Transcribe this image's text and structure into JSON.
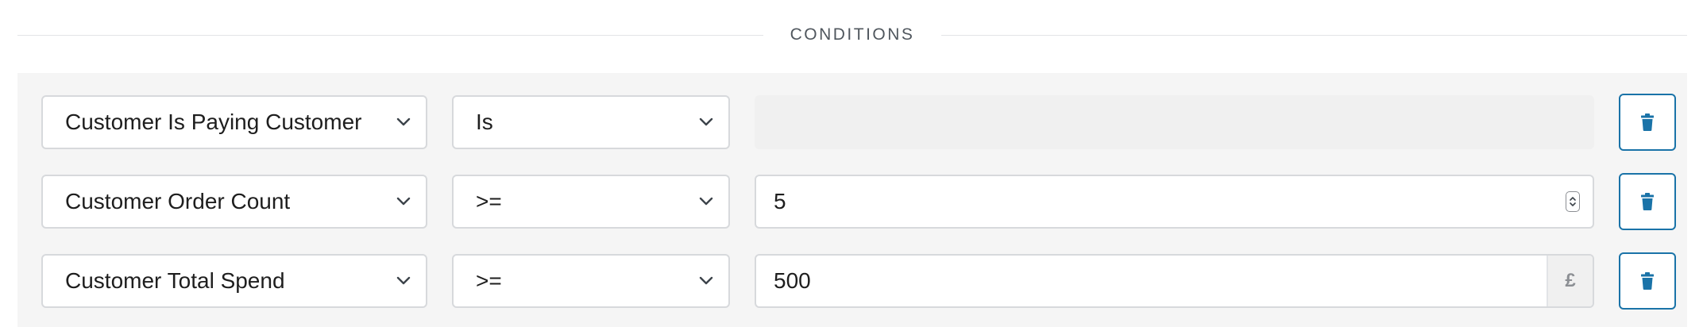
{
  "section": {
    "title": "CONDITIONS"
  },
  "conditions": [
    {
      "field": "Customer Is Paying Customer",
      "operator": "Is",
      "value": "",
      "value_state": "disabled"
    },
    {
      "field": "Customer Order Count",
      "operator": ">=",
      "value": "5",
      "value_state": "number"
    },
    {
      "field": "Customer Total Spend",
      "operator": ">=",
      "value": "500",
      "value_state": "currency",
      "currency_symbol": "£"
    }
  ],
  "icons": {
    "select_arrow": "chevron-down-icon",
    "delete": "trash-icon",
    "number_spin": "spinner-icon"
  },
  "colors": {
    "accent": "#1a73a8",
    "panel_bg": "#f5f5f5",
    "border": "#d7d9dc",
    "disabled_bg": "#f0f0f0"
  }
}
